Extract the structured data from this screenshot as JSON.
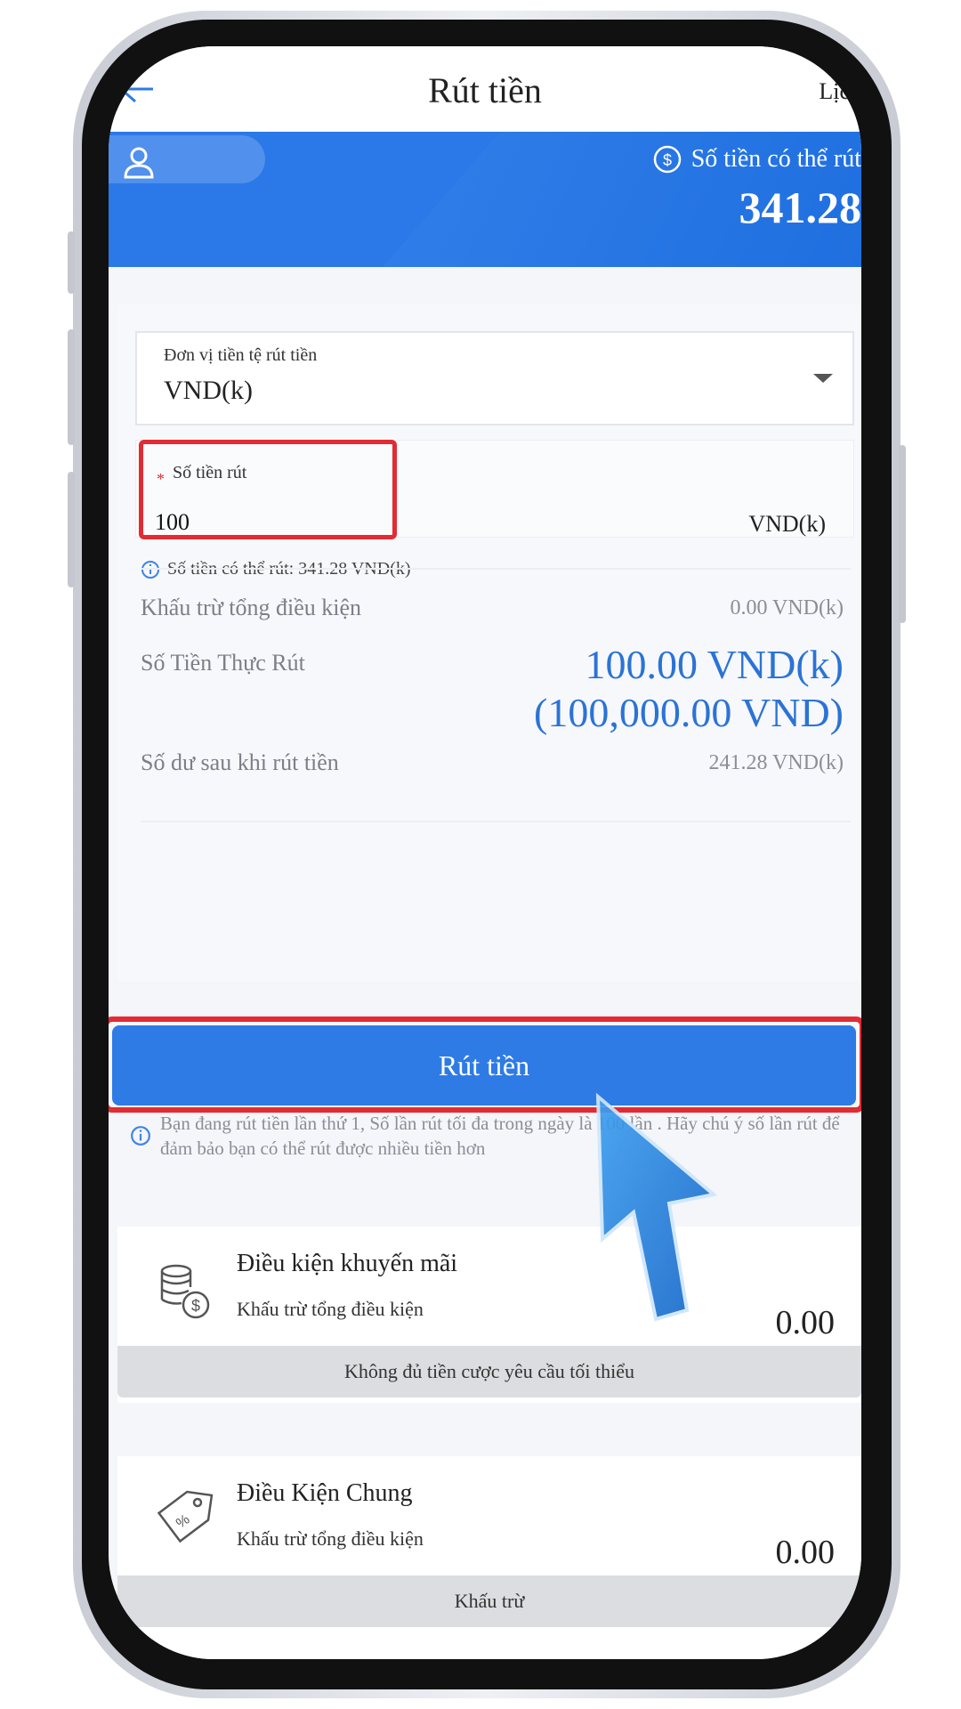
{
  "header": {
    "title": "Rút tiền",
    "history_label": "Lịch"
  },
  "banner": {
    "available_label": "Số tiền có thể rút",
    "available_amount": "341.28"
  },
  "form": {
    "currency_label": "Đơn vị tiền tệ rút tiền",
    "currency_value": "VND(k)",
    "amount_label": "Số tiền rút",
    "amount_value": "100",
    "amount_unit": "VND(k)",
    "hint": "Số tiền có thể rút: 341.28 VND(k)"
  },
  "summary": {
    "deduction_label": "Khấu trừ tổng điều kiện",
    "deduction_value": "0.00 VND(k)",
    "actual_label": "Số Tiền Thực Rút",
    "actual_value_1": "100.00 VND(k)",
    "actual_value_2": "(100,000.00 VND)",
    "balance_label": "Số dư sau khi rút tiền",
    "balance_value": "241.28 VND(k)"
  },
  "submit_label": "Rút tiền",
  "notice": "Bạn đang rút tiền lần thứ 1, Số lần rút tối đa trong ngày là 100 lần . Hãy chú ý số lần rút để đảm bảo bạn có thể rút được nhiều tiền hơn",
  "panels": [
    {
      "title": "Điều kiện khuyến mãi",
      "subtitle": "Khấu trừ tổng điều kiện",
      "amount": "0.00",
      "footer": "Không đủ tiền cược yêu cầu tối thiểu",
      "icon": "coins-dollar-icon"
    },
    {
      "title": "Điều Kiện Chung",
      "subtitle": "Khấu trừ tổng điều kiện",
      "amount": "0.00",
      "footer": "Khấu trừ",
      "icon": "price-tag-icon"
    }
  ],
  "colors": {
    "accent": "#2e7be6",
    "highlight": "#e22b32",
    "value_blue": "#2b73d6"
  }
}
